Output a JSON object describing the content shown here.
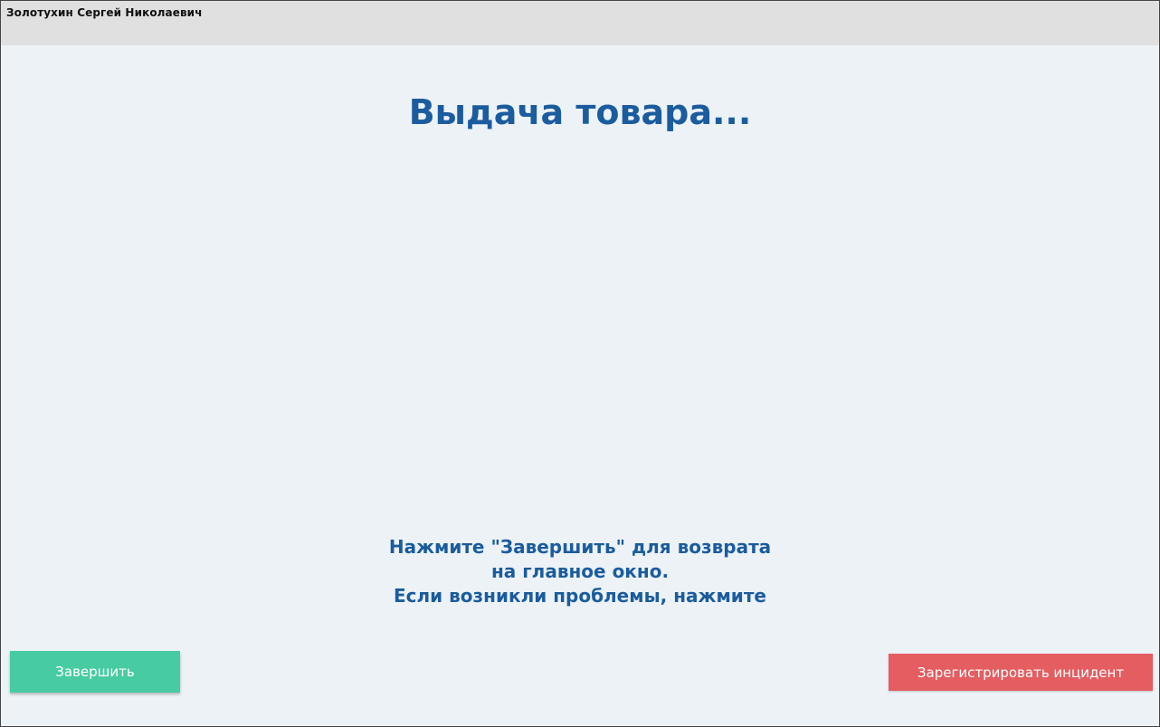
{
  "header": {
    "user_name": "Золотухин Сергей Николаевич"
  },
  "main": {
    "title": "Выдача товара...",
    "message_lines": [
      "Нажмите \"Завершить\" для возврата",
      "на главное окно.",
      "Если возникли проблемы, нажмите"
    ]
  },
  "buttons": {
    "finish_label": "Завершить",
    "incident_label": "Зарегистрировать инцидент"
  },
  "colors": {
    "accent_text": "#1b5c9e",
    "finish_button": "#47cba2",
    "incident_button": "#e35d61",
    "header_bar": "#e0e0e0",
    "background": "#edf2f7"
  }
}
